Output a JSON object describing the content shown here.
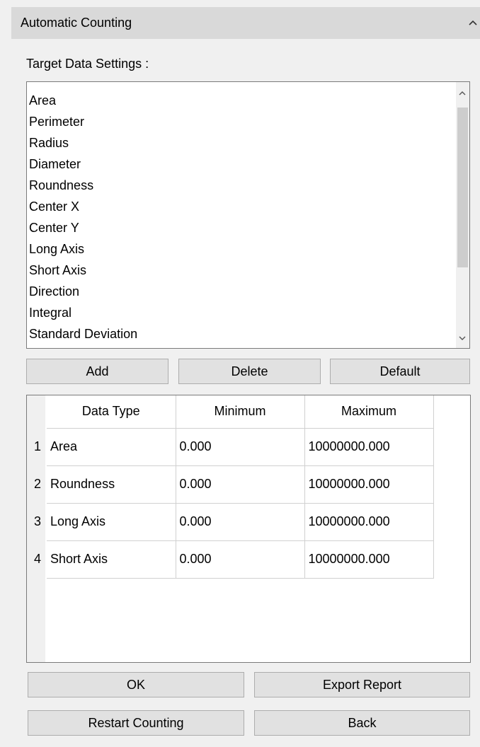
{
  "panel": {
    "title": "Automatic Counting",
    "collapse_icon": "chevron-up-icon"
  },
  "target_settings": {
    "label": "Target Data Settings :",
    "items": [
      "Area",
      "Perimeter",
      "Radius",
      "Diameter",
      "Roundness",
      "Center X",
      "Center Y",
      "Long Axis",
      "Short Axis",
      "Direction",
      "Integral",
      "Standard Deviation"
    ]
  },
  "list_buttons": {
    "add": "Add",
    "delete": "Delete",
    "default": "Default"
  },
  "table": {
    "headers": [
      "Data Type",
      "Minimum",
      "Maximum"
    ],
    "rows": [
      {
        "index": "1",
        "type": "Area",
        "min": "0.000",
        "max": "10000000.000"
      },
      {
        "index": "2",
        "type": "Roundness",
        "min": "0.000",
        "max": "10000000.000"
      },
      {
        "index": "3",
        "type": "Long Axis",
        "min": "0.000",
        "max": "10000000.000"
      },
      {
        "index": "4",
        "type": "Short Axis",
        "min": "0.000",
        "max": "10000000.000"
      }
    ]
  },
  "footer_buttons": {
    "ok": "OK",
    "export": "Export Report",
    "restart": "Restart Counting",
    "back": "Back"
  }
}
